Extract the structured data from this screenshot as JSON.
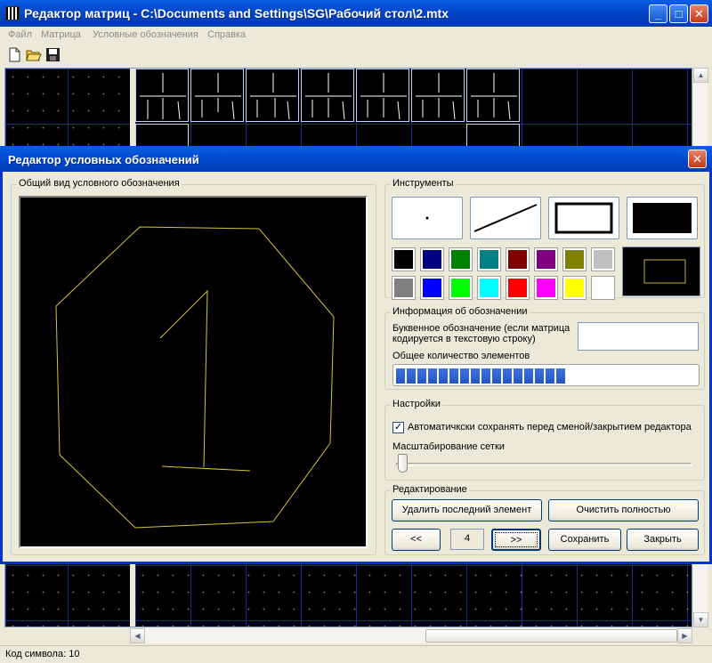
{
  "main_window": {
    "title": "Редактор матриц - C:\\Documents and Settings\\SG\\Рабочий стол\\2.mtx",
    "minimize_glyph": "_",
    "maximize_glyph": "□",
    "close_glyph": "✕"
  },
  "menu": [
    "Файл",
    "Матрица",
    "Условные обозначения",
    "Справка"
  ],
  "toolbar": {
    "icons": [
      "new-file-icon",
      "open-folder-icon",
      "save-disk-icon"
    ]
  },
  "status_bar": {
    "label": "Код символа:",
    "value": "10"
  },
  "dialog": {
    "title": "Редактор условных обозначений",
    "close_glyph": "✕",
    "preview_group": {
      "legend": "Общий вид условного обозначения"
    },
    "tools_group": {
      "legend": "Инструменты",
      "tools": [
        "point-tool",
        "line-tool",
        "rectangle-tool",
        "filled-rectangle-tool"
      ],
      "colors": [
        "#000000",
        "#000080",
        "#008000",
        "#008080",
        "#800000",
        "#800080",
        "#808000",
        "#c0c0c0",
        "#808080",
        "#0000ff",
        "#00ff00",
        "#00ffff",
        "#ff0000",
        "#ff00ff",
        "#ffff00",
        "#ffffff"
      ],
      "current_color": "#c0b030"
    },
    "info_group": {
      "legend": "Информация об обозначении",
      "letter_label_line1": "Буквенное обозначение (если матрица",
      "letter_label_line2": "кодируется в текстовую строку)",
      "letter_value": "",
      "count_label": "Общее количество элементов",
      "count_progress": 0.56
    },
    "settings_group": {
      "legend": "Настройки",
      "autosave_label": "Автоматичкски сохранять перед сменой/закрытием редактора",
      "autosave_checked": "✓",
      "scale_label": "Масштабирование сетки",
      "scale_value": 0
    },
    "edit_group": {
      "legend": "Редактирование",
      "delete_last": "Удалить последний элемент",
      "clear_all": "Очистить полностью",
      "prev": "<<",
      "page": "4",
      "next": ">>",
      "save": "Сохранить",
      "close": "Закрыть"
    }
  }
}
